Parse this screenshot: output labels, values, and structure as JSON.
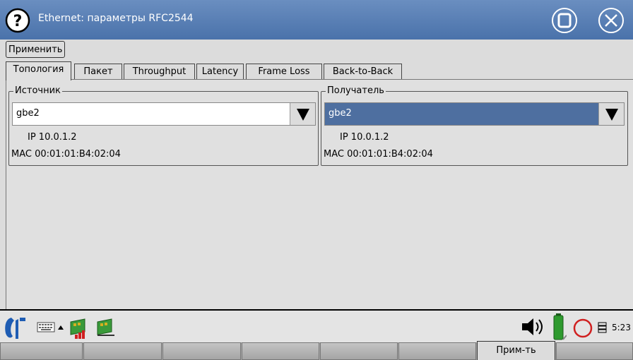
{
  "window": {
    "title": "Ethernet: параметры RFC2544",
    "help_icon": "question-circle-icon",
    "maximize_icon": "restore-window-icon",
    "close_icon": "close-circle-icon"
  },
  "toolbar": {
    "apply_label": "Применить"
  },
  "tabs": [
    {
      "label": "Топология",
      "active": true
    },
    {
      "label": "Пакет"
    },
    {
      "label": "Throughput"
    },
    {
      "label": "Latency"
    },
    {
      "label": "Frame Loss"
    },
    {
      "label": "Back-to-Back"
    }
  ],
  "source": {
    "legend": "Источник",
    "interface": "gbe2",
    "ip": "IP 10.0.1.2",
    "mac": "MAC 00:01:01:B4:02:04"
  },
  "destination": {
    "legend": "Получатель",
    "interface": "gbe2",
    "ip": "IP 10.0.1.2",
    "mac": "MAC 00:01:01:B4:02:04"
  },
  "taskbar": {
    "clock": "5:23"
  },
  "function_keys": [
    "",
    "",
    "",
    "",
    "",
    "",
    "Прим-ть",
    ""
  ],
  "colors": {
    "titlebar": "#5a80b8",
    "selected_combo": "#4e6fa0",
    "battery": "#2e9a2e",
    "record": "#d02020"
  }
}
